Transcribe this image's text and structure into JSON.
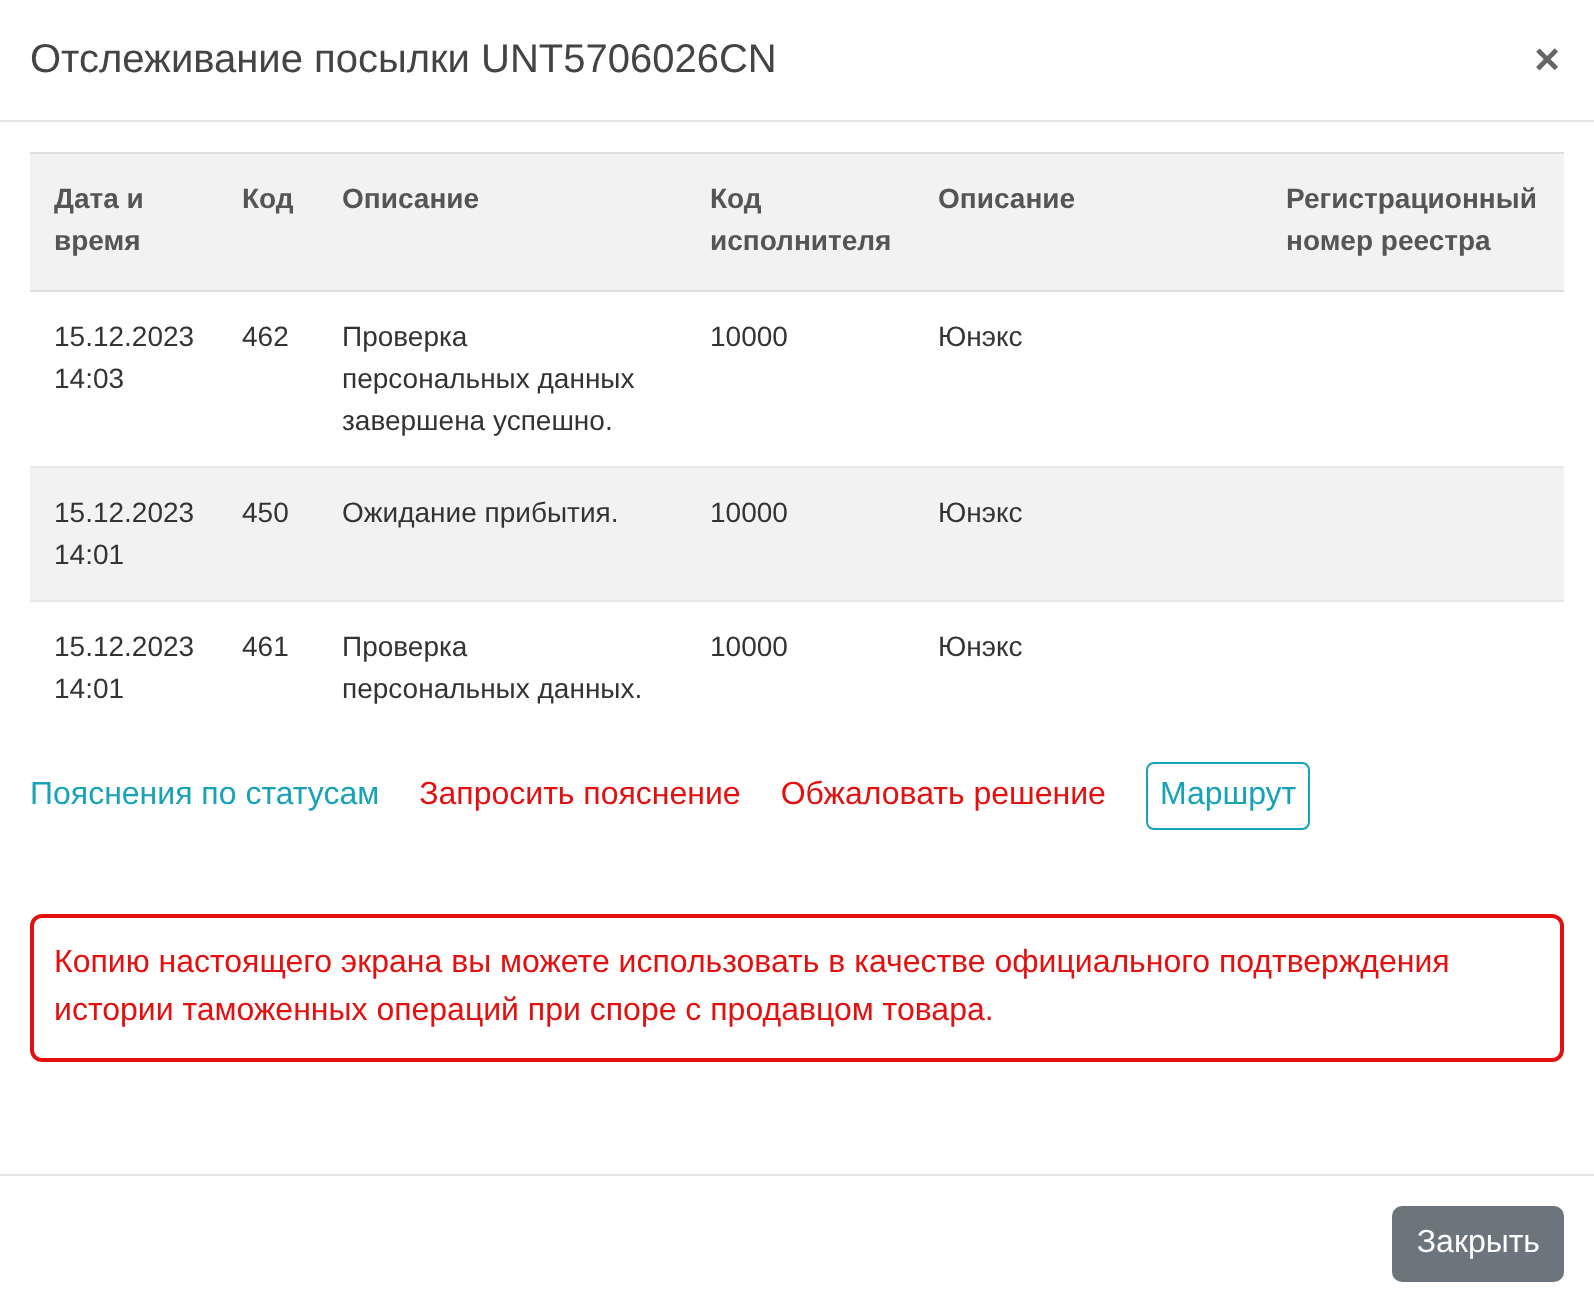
{
  "modal": {
    "title": "Отслеживание посылки UNT5706026CN",
    "close_icon": "×"
  },
  "table": {
    "columns": [
      "Дата и время",
      "Код",
      "Описание",
      "Код исполнителя",
      "Описание",
      "Регистрационный номер реестра"
    ],
    "rows": [
      {
        "cells": [
          "15.12.2023 14:03",
          "462",
          "Проверка персональных данных завершена успешно.",
          "10000",
          "Юнэкс",
          ""
        ]
      },
      {
        "cells": [
          "15.12.2023 14:01",
          "450",
          "Ожидание прибытия.",
          "10000",
          "Юнэкс",
          ""
        ]
      },
      {
        "cells": [
          "15.12.2023 14:01",
          "461",
          "Проверка персональных данных.",
          "10000",
          "Юнэкс",
          ""
        ]
      }
    ]
  },
  "actions": [
    {
      "kind": "link",
      "label": "Пояснения по статусам",
      "color": "#17a2b8"
    },
    {
      "kind": "link",
      "label": "Запросить пояснение",
      "color": "#e3100f"
    },
    {
      "kind": "link",
      "label": "Обжаловать решение",
      "color": "#e3100f"
    },
    {
      "kind": "outline",
      "label": "Маршрут",
      "color": "#17a2b8"
    }
  ],
  "alert": {
    "text": "Копию настоящего экрана вы можете использовать в качестве официального подтверждения истории таможенных операций при споре с продавцом товара."
  },
  "footer": {
    "buttons": [
      "Закрыть"
    ]
  }
}
